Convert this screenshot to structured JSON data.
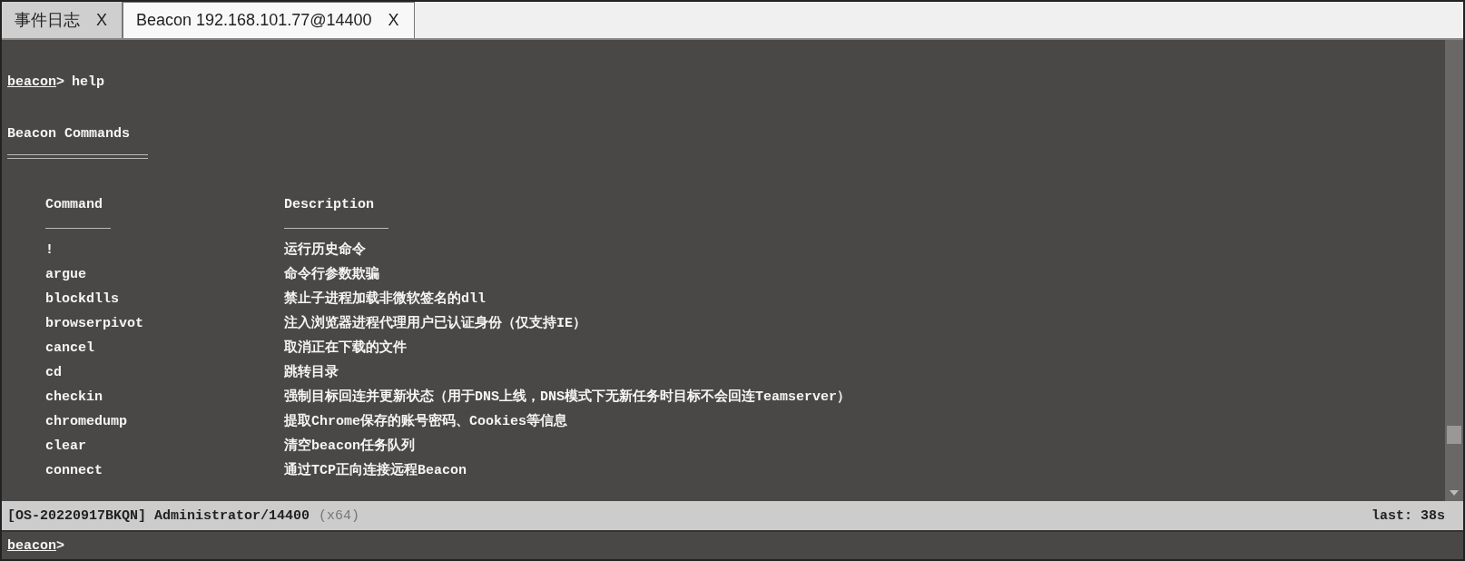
{
  "tabs": [
    {
      "label": "事件日志",
      "close": "X",
      "selected": false
    },
    {
      "label": "Beacon 192.168.101.77@14400",
      "close": "X",
      "selected": true
    }
  ],
  "console": {
    "prompt": "beacon",
    "prompt_sign": ">",
    "command": "help",
    "heading": "Beacon Commands",
    "columns": [
      "Command",
      "Description"
    ],
    "rows": [
      {
        "command": "!",
        "description": "运行历史命令"
      },
      {
        "command": "argue",
        "description": "命令行参数欺骗"
      },
      {
        "command": "blockdlls",
        "description": "禁止子进程加载非微软签名的dll"
      },
      {
        "command": "browserpivot",
        "description": "注入浏览器进程代理用户已认证身份（仅支持IE）"
      },
      {
        "command": "cancel",
        "description": "取消正在下载的文件"
      },
      {
        "command": "cd",
        "description": "跳转目录"
      },
      {
        "command": "checkin",
        "description": "强制目标回连并更新状态（用于DNS上线，DNS模式下无新任务时目标不会回连Teamserver）"
      },
      {
        "command": "chromedump",
        "description": "提取Chrome保存的账号密码、Cookies等信息"
      },
      {
        "command": "clear",
        "description": "清空beacon任务队列"
      },
      {
        "command": "connect",
        "description": "通过TCP正向连接远程Beacon"
      }
    ]
  },
  "status_bar": {
    "session": "[OS-20220917BKQN] Administrator/14400",
    "arch": "(x64)",
    "last": "last: 38s"
  },
  "input": {
    "prompt": "beacon",
    "prompt_sign": ">"
  }
}
